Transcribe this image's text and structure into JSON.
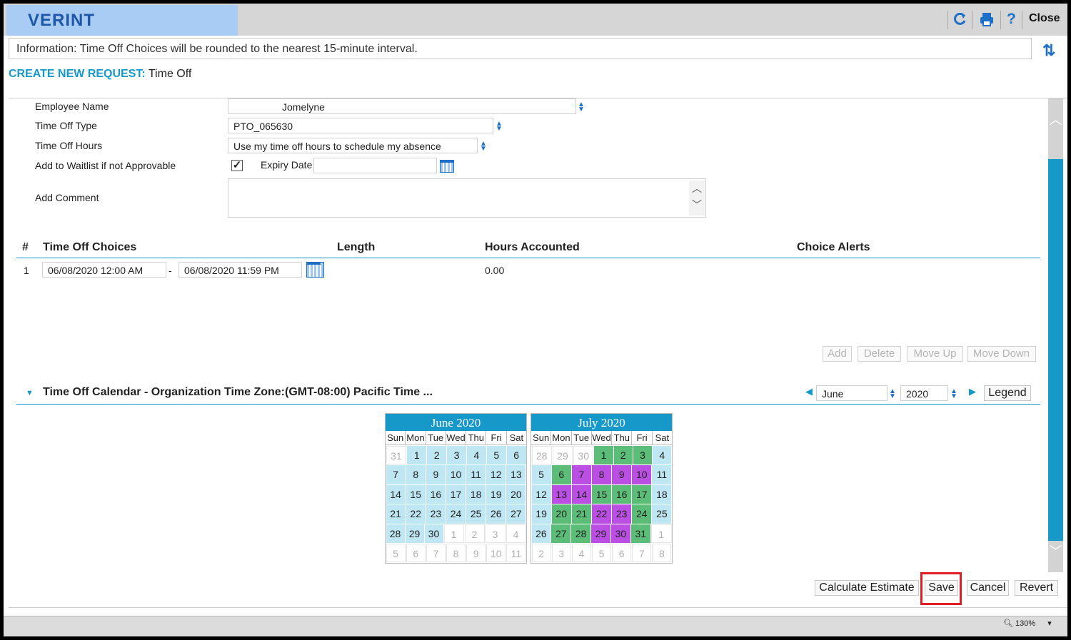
{
  "header": {
    "logo": "VERINT",
    "close_label": "Close",
    "help_glyph": "?",
    "icons": [
      "refresh-icon",
      "print-icon",
      "help-icon"
    ]
  },
  "info": {
    "text": "Information: Time Off Choices will be rounded to the nearest 15-minute interval."
  },
  "page_title": {
    "prefix": "CREATE NEW REQUEST:",
    "suffix": "Time Off"
  },
  "form": {
    "employee_name_label": "Employee Name",
    "employee_name_value": "Jomelyne",
    "time_off_type_label": "Time Off Type",
    "time_off_type_value": "PTO_065630",
    "time_off_hours_label": "Time Off Hours",
    "time_off_hours_value": "Use my time off hours to schedule my absence",
    "waitlist_label": "Add to Waitlist if not Approvable",
    "waitlist_checked": true,
    "checkmark": "✓",
    "expiry_label": "Expiry Date",
    "expiry_value": "",
    "comment_label": "Add Comment",
    "comment_value": ""
  },
  "choices_table": {
    "headers": {
      "num": "#",
      "choices": "Time Off Choices",
      "length": "Length",
      "hours": "Hours Accounted",
      "alerts": "Choice Alerts"
    },
    "rows": [
      {
        "num": "1",
        "start": "06/08/2020 12:00 AM",
        "dash": "-",
        "end": "06/08/2020 11:59 PM",
        "hours": "0.00"
      }
    ],
    "buttons": {
      "add": "Add",
      "delete": "Delete",
      "move_up": "Move Up",
      "move_down": "Move Down"
    }
  },
  "calendar": {
    "title": "Time Off Calendar - Organization Time Zone:(GMT-08:00) Pacific Time ...",
    "month_value": "June",
    "year_value": "2020",
    "legend_label": "Legend",
    "colors": {
      "current_month": "#bfe6f3",
      "green": "#5bbd77",
      "purple": "#bb4ee3",
      "header": "#1698c9"
    },
    "months": [
      {
        "title": "June 2020",
        "dow": [
          "Sun",
          "Mon",
          "Tue",
          "Wed",
          "Thu",
          "Fri",
          "Sat"
        ],
        "weeks": [
          [
            {
              "d": "31",
              "s": "out"
            },
            {
              "d": "1",
              "s": "cur"
            },
            {
              "d": "2",
              "s": "cur"
            },
            {
              "d": "3",
              "s": "cur"
            },
            {
              "d": "4",
              "s": "cur"
            },
            {
              "d": "5",
              "s": "cur"
            },
            {
              "d": "6",
              "s": "cur"
            }
          ],
          [
            {
              "d": "7",
              "s": "cur"
            },
            {
              "d": "8",
              "s": "cur"
            },
            {
              "d": "9",
              "s": "cur"
            },
            {
              "d": "10",
              "s": "cur"
            },
            {
              "d": "11",
              "s": "cur"
            },
            {
              "d": "12",
              "s": "cur"
            },
            {
              "d": "13",
              "s": "cur"
            }
          ],
          [
            {
              "d": "14",
              "s": "cur"
            },
            {
              "d": "15",
              "s": "cur"
            },
            {
              "d": "16",
              "s": "cur"
            },
            {
              "d": "17",
              "s": "cur"
            },
            {
              "d": "18",
              "s": "cur"
            },
            {
              "d": "19",
              "s": "cur"
            },
            {
              "d": "20",
              "s": "cur"
            }
          ],
          [
            {
              "d": "21",
              "s": "cur"
            },
            {
              "d": "22",
              "s": "cur"
            },
            {
              "d": "23",
              "s": "cur"
            },
            {
              "d": "24",
              "s": "cur"
            },
            {
              "d": "25",
              "s": "cur"
            },
            {
              "d": "26",
              "s": "cur"
            },
            {
              "d": "27",
              "s": "cur"
            }
          ],
          [
            {
              "d": "28",
              "s": "cur"
            },
            {
              "d": "29",
              "s": "cur"
            },
            {
              "d": "30",
              "s": "cur"
            },
            {
              "d": "1",
              "s": "out"
            },
            {
              "d": "2",
              "s": "out"
            },
            {
              "d": "3",
              "s": "out"
            },
            {
              "d": "4",
              "s": "out"
            }
          ],
          [
            {
              "d": "5",
              "s": "out"
            },
            {
              "d": "6",
              "s": "out"
            },
            {
              "d": "7",
              "s": "out"
            },
            {
              "d": "8",
              "s": "out"
            },
            {
              "d": "9",
              "s": "out"
            },
            {
              "d": "10",
              "s": "out"
            },
            {
              "d": "11",
              "s": "out"
            }
          ]
        ]
      },
      {
        "title": "July 2020",
        "dow": [
          "Sun",
          "Mon",
          "Tue",
          "Wed",
          "Thu",
          "Fri",
          "Sat"
        ],
        "weeks": [
          [
            {
              "d": "28",
              "s": "out"
            },
            {
              "d": "29",
              "s": "out"
            },
            {
              "d": "30",
              "s": "out"
            },
            {
              "d": "1",
              "s": "green"
            },
            {
              "d": "2",
              "s": "green"
            },
            {
              "d": "3",
              "s": "green"
            },
            {
              "d": "4",
              "s": "cur"
            }
          ],
          [
            {
              "d": "5",
              "s": "cur"
            },
            {
              "d": "6",
              "s": "green"
            },
            {
              "d": "7",
              "s": "purple"
            },
            {
              "d": "8",
              "s": "purple"
            },
            {
              "d": "9",
              "s": "purple"
            },
            {
              "d": "10",
              "s": "purple"
            },
            {
              "d": "11",
              "s": "cur"
            }
          ],
          [
            {
              "d": "12",
              "s": "cur"
            },
            {
              "d": "13",
              "s": "purple"
            },
            {
              "d": "14",
              "s": "purple"
            },
            {
              "d": "15",
              "s": "green"
            },
            {
              "d": "16",
              "s": "green"
            },
            {
              "d": "17",
              "s": "green"
            },
            {
              "d": "18",
              "s": "cur"
            }
          ],
          [
            {
              "d": "19",
              "s": "cur"
            },
            {
              "d": "20",
              "s": "green"
            },
            {
              "d": "21",
              "s": "green"
            },
            {
              "d": "22",
              "s": "purple"
            },
            {
              "d": "23",
              "s": "purple"
            },
            {
              "d": "24",
              "s": "green"
            },
            {
              "d": "25",
              "s": "cur"
            }
          ],
          [
            {
              "d": "26",
              "s": "cur"
            },
            {
              "d": "27",
              "s": "green"
            },
            {
              "d": "28",
              "s": "green"
            },
            {
              "d": "29",
              "s": "purple"
            },
            {
              "d": "30",
              "s": "purple"
            },
            {
              "d": "31",
              "s": "green"
            },
            {
              "d": "1",
              "s": "out"
            }
          ],
          [
            {
              "d": "2",
              "s": "out"
            },
            {
              "d": "3",
              "s": "out"
            },
            {
              "d": "4",
              "s": "out"
            },
            {
              "d": "5",
              "s": "out"
            },
            {
              "d": "6",
              "s": "out"
            },
            {
              "d": "7",
              "s": "out"
            },
            {
              "d": "8",
              "s": "out"
            }
          ]
        ]
      }
    ]
  },
  "actions": {
    "calculate": "Calculate Estimate",
    "save": "Save",
    "cancel": "Cancel",
    "revert": "Revert"
  },
  "status_bar": {
    "zoom": "130%"
  }
}
